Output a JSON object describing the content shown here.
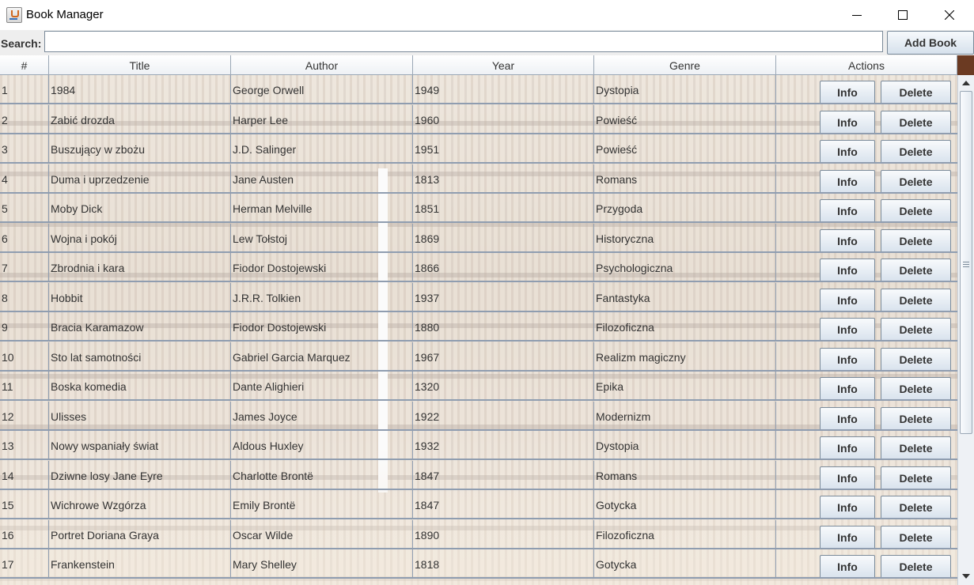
{
  "window": {
    "title": "Book Manager",
    "icon": "java-cup-icon"
  },
  "search": {
    "label": "Search:",
    "value": "",
    "placeholder": ""
  },
  "toolbar": {
    "add_book_label": "Add Book"
  },
  "table": {
    "columns": [
      "#",
      "Title",
      "Author",
      "Year",
      "Genre",
      "Actions"
    ],
    "info_label": "Info",
    "delete_label": "Delete",
    "rows": [
      {
        "num": "1",
        "title": "1984",
        "author": "George Orwell",
        "year": "1949",
        "genre": "Dystopia"
      },
      {
        "num": "2",
        "title": "Zabić drozda",
        "author": "Harper Lee",
        "year": "1960",
        "genre": "Powieść"
      },
      {
        "num": "3",
        "title": "Buszujący w zbożu",
        "author": "J.D. Salinger",
        "year": "1951",
        "genre": "Powieść"
      },
      {
        "num": "4",
        "title": "Duma i uprzedzenie",
        "author": "Jane Austen",
        "year": "1813",
        "genre": "Romans"
      },
      {
        "num": "5",
        "title": "Moby Dick",
        "author": "Herman Melville",
        "year": "1851",
        "genre": "Przygoda"
      },
      {
        "num": "6",
        "title": "Wojna i pokój",
        "author": "Lew Tołstoj",
        "year": "1869",
        "genre": "Historyczna"
      },
      {
        "num": "7",
        "title": "Zbrodnia i kara",
        "author": "Fiodor Dostojewski",
        "year": "1866",
        "genre": "Psychologiczna"
      },
      {
        "num": "8",
        "title": "Hobbit",
        "author": "J.R.R. Tolkien",
        "year": "1937",
        "genre": "Fantastyka"
      },
      {
        "num": "9",
        "title": "Bracia Karamazow",
        "author": "Fiodor Dostojewski",
        "year": "1880",
        "genre": "Filozoficzna"
      },
      {
        "num": "10",
        "title": "Sto lat samotności",
        "author": "Gabriel Garcia Marquez",
        "year": "1967",
        "genre": "Realizm magiczny"
      },
      {
        "num": "11",
        "title": "Boska komedia",
        "author": "Dante Alighieri",
        "year": "1320",
        "genre": "Epika"
      },
      {
        "num": "12",
        "title": "Ulisses",
        "author": "James Joyce",
        "year": "1922",
        "genre": "Modernizm"
      },
      {
        "num": "13",
        "title": "Nowy wspaniały świat",
        "author": "Aldous Huxley",
        "year": "1932",
        "genre": "Dystopia"
      },
      {
        "num": "14",
        "title": "Dziwne losy Jane Eyre",
        "author": "Charlotte Brontë",
        "year": "1847",
        "genre": "Romans"
      },
      {
        "num": "15",
        "title": "Wichrowe Wzgórza",
        "author": "Emily Brontë",
        "year": "1847",
        "genre": "Gotycka"
      },
      {
        "num": "16",
        "title": "Portret Doriana Graya",
        "author": "Oscar Wilde",
        "year": "1890",
        "genre": "Filozoficzna"
      },
      {
        "num": "17",
        "title": "Frankenstein",
        "author": "Mary Shelley",
        "year": "1818",
        "genre": "Gotycka"
      }
    ]
  },
  "colors": {
    "grid_line": "#8f9db0",
    "header_bg": "#eef1f5",
    "button_bg": "#d8e2ed",
    "text": "#333333"
  },
  "background": "library-bookshelves-image"
}
